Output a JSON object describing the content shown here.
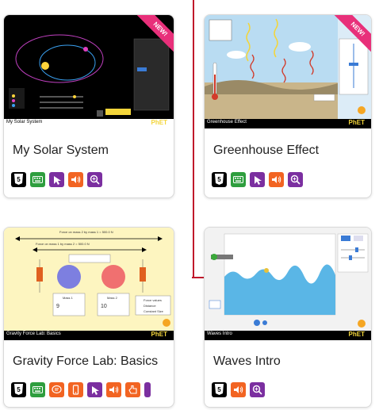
{
  "cards": [
    {
      "title": "My Solar System",
      "badge": "NEW!",
      "footer": "My Solar System",
      "phet": "PhET",
      "icons": [
        "html5-icon",
        "keyboard-icon",
        "mouse-pointer-icon",
        "sound-icon",
        "zoom-icon"
      ]
    },
    {
      "title": "Greenhouse Effect",
      "badge": "NEW!",
      "footer": "Greenhouse Effect",
      "phet": "PhET",
      "icons": [
        "html5-icon",
        "keyboard-icon",
        "mouse-pointer-icon",
        "sound-icon",
        "zoom-icon"
      ]
    },
    {
      "title": "Gravity Force Lab: Basics",
      "footer": "Gravity Force Lab: Basics",
      "phet": "PhET",
      "force_top": "Force on mass 2 by mass 1 = 500.0 N",
      "force_bottom": "Force on mass 1 by mass 2 = 500.0 N",
      "mass1_label": "Mass 1",
      "mass1_value": "9",
      "mass2_label": "Mass 2",
      "mass2_value": "10",
      "options": [
        "Force values",
        "Distance",
        "Constant Size"
      ],
      "icons": [
        "html5-icon",
        "keyboard-icon",
        "speech-icon",
        "mobile-icon",
        "mouse-pointer-icon",
        "sound-icon",
        "hand-icon",
        "extra-icon"
      ]
    },
    {
      "title": "Waves Intro",
      "footer": "Waves Intro",
      "phet": "PhET",
      "icons": [
        "html5-icon",
        "sound-icon",
        "zoom-icon"
      ]
    }
  ],
  "colors": {
    "keyboard": "#2e9e3e",
    "pointer": "#7b2fa0",
    "sound": "#f26422",
    "zoom": "#7b2fa0",
    "speech": "#f26422",
    "mobile": "#f26422",
    "arrow": "#c0182b"
  }
}
